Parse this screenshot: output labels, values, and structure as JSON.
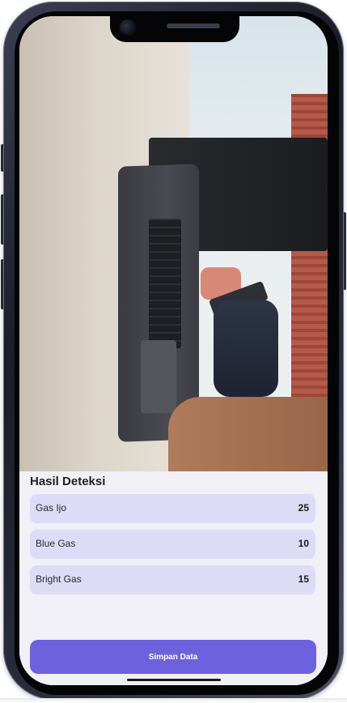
{
  "results_panel": {
    "title": "Hasil Deteksi",
    "items": [
      {
        "name": "Gas Ijo",
        "count": "25"
      },
      {
        "name": "Blue Gas",
        "count": "10"
      },
      {
        "name": "Bright Gas",
        "count": "15"
      }
    ]
  },
  "actions": {
    "save_label": "Simpan Data"
  },
  "colors": {
    "accent": "#6e61de",
    "row_background": "#dedbf7",
    "panel_background": "#f1f0f7"
  }
}
